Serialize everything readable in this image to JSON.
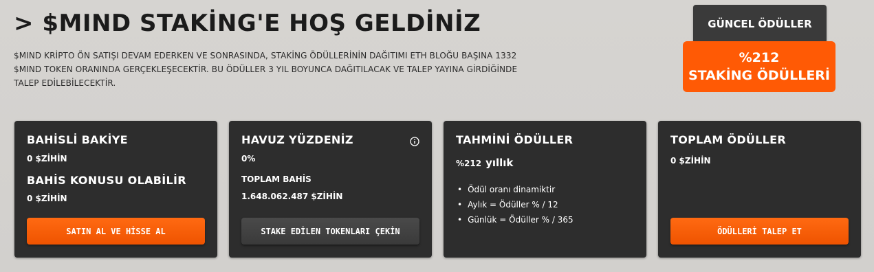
{
  "header": {
    "title": "> $MIND STAKİNG'E HOŞ GELDİNİZ",
    "intro_line1": "$MIND KRİPTO ÖN SATIŞI DEVAM EDERKEN VE SONRASINDA, STAKİNG ÖDÜLLERİNİN DAĞITIMI ETH BLOĞU BAŞINA 1332",
    "intro_line2": "$MIND TOKEN ORANINDA GERÇEKLEŞECEKTİR. BU ÖDÜLLER 3 YIL BOYUNCA DAĞITILACAK VE TALEP YAYINA GİRDİĞİNDE",
    "intro_line3": "TALEP EDİLEBİLECEKTİR."
  },
  "current_rewards_button": "GÜNCEL ÖDÜLLER",
  "rewards_badge": {
    "line1": "%212",
    "line2": "STAKİNG ÖDÜLLERİ"
  },
  "cards": {
    "staked_balance": {
      "title": "BAHİSLİ BAKİYE",
      "value": "0 $ZİHİN",
      "sub_title": "BAHİS KONUSU OLABİLİR",
      "sub_value": "0 $ZİHİN",
      "button": "SATIN AL VE HİSSE AL"
    },
    "pool_share": {
      "title": "HAVUZ YÜZDENİZ",
      "value": "0%",
      "sub_title": "TOPLAM BAHİS",
      "sub_value": "1.648.062.487 $ZİHİN",
      "button": "STAKE EDİLEN TOKENLARI ÇEKİN"
    },
    "estimated_rewards": {
      "title": "TAHMİNİ ÖDÜLLER",
      "rate": "%212",
      "rate_unit": "yıllık",
      "notes": [
        "Ödül oranı dinamiktir",
        "Aylık = Ödüller % / 12",
        "Günlük = Ödüller % / 365"
      ]
    },
    "total_rewards": {
      "title": "TOPLAM ÖDÜLLER",
      "value": "0 $ZİHİN",
      "button": "ÖDÜLLERİ TALEP ET"
    }
  },
  "colors": {
    "accent": "#ff5a05",
    "card_bg": "#2d2d2d",
    "page_bg": "#d4d2cf"
  }
}
